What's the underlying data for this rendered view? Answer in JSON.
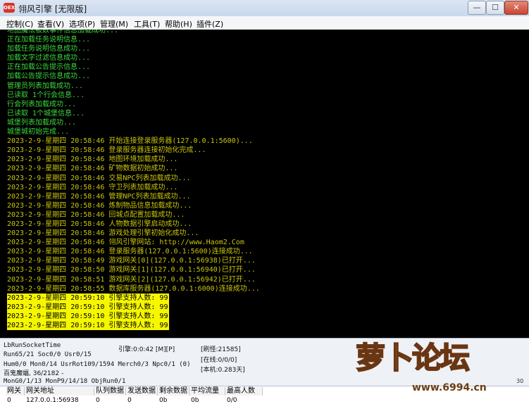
{
  "window": {
    "icon_label": "OEX",
    "title": "翎风引擎 [无限版]",
    "controls": {
      "minimize": "—",
      "maximize": "☐",
      "close": "✕"
    }
  },
  "menu": [
    "控制(C)",
    "查看(V)",
    "选项(P)",
    "管理(M)",
    "工具(T)",
    "帮助(H)",
    "插件(Z)"
  ],
  "console": {
    "lines": [
      {
        "text": "地图魔法被数事件信息加载成功...",
        "style": "green"
      },
      {
        "text": "正在加载任务说明信息...",
        "style": "green"
      },
      {
        "text": "加载任务说明信息成功...",
        "style": "green"
      },
      {
        "text": "加载文字过滤信息成功...",
        "style": "green"
      },
      {
        "text": "正在加载公告提示信息...",
        "style": "green"
      },
      {
        "text": "加载公告提示信息成功...",
        "style": "green"
      },
      {
        "text": "管理员列表加载成功...",
        "style": "green"
      },
      {
        "text": "已读取 1个行会信息...",
        "style": "green"
      },
      {
        "text": "行会列表加载成功...",
        "style": "green"
      },
      {
        "text": "已读取 1个城堡信息...",
        "style": "green"
      },
      {
        "text": "城堡列表加载成功...",
        "style": "green"
      },
      {
        "text": "城堡城初始完成...",
        "style": "green"
      },
      {
        "text": "2023-2-9-星期四 20:58:46 开始连接登录服务器(127.0.0.1:5600)...",
        "style": "olive"
      },
      {
        "text": "2023-2-9-星期四 20:58:46 登录服务器连接初始化完成...",
        "style": "olive"
      },
      {
        "text": "2023-2-9-星期四 20:58:46 地图环境加载成功...",
        "style": "olive"
      },
      {
        "text": "2023-2-9-星期四 20:58:46 矿物数据初始成功...",
        "style": "olive"
      },
      {
        "text": "2023-2-9-星期四 20:58:46 交易NPC列表加载成功...",
        "style": "olive"
      },
      {
        "text": "2023-2-9-星期四 20:58:46 守卫列表加载成功...",
        "style": "olive"
      },
      {
        "text": "2023-2-9-星期四 20:58:46 管理NPC列表加载成功...",
        "style": "olive"
      },
      {
        "text": "2023-2-9-星期四 20:58:46 炼制物品信息加载成功...",
        "style": "olive"
      },
      {
        "text": "2023-2-9-星期四 20:58:46 回城点配置加载成功...",
        "style": "olive"
      },
      {
        "text": "2023-2-9-星期四 20:58:46 人物数据引擎启动成功...",
        "style": "olive"
      },
      {
        "text": "2023-2-9-星期四 20:58:46 游戏处理引擎初始化成功...",
        "style": "olive"
      },
      {
        "text": "2023-2-9-星期四 20:58:46 翎风引擎网站: http://www.Haom2.Com",
        "style": "olive"
      },
      {
        "text": "2023-2-9-星期四 20:58:46 登录服务器(127.0.0.1:5600)连接成功...",
        "style": "olive"
      },
      {
        "text": "2023-2-9-星期四 20:58:49 游戏网关[0](127.0.0.1:56938)已打开...",
        "style": "olive"
      },
      {
        "text": "2023-2-9-星期四 20:58:50 游戏网关[1](127.0.0.1:56940)已打开...",
        "style": "olive"
      },
      {
        "text": "2023-2-9-星期四 20:58:51 游戏网关[2](127.0.0.1:56942)已打开...",
        "style": "olive"
      },
      {
        "text": "2023-2-9-星期四 20:58:55 数据库服务器(127.0.0.1:6000)连接成功...",
        "style": "olive"
      },
      {
        "text": "2023-2-9-星期四 20:59:10 引擎支持人数: 99",
        "style": "hl"
      },
      {
        "text": "2023-2-9-星期四 20:59:10 引擎支持人数: 99",
        "style": "hl"
      },
      {
        "text": "2023-2-9-星期四 20:59:10 引擎支持人数: 99",
        "style": "hl"
      },
      {
        "text": "2023-2-9-星期四 20:59:10 引擎支持人数: 99",
        "style": "hl"
      }
    ]
  },
  "status": {
    "run_socket": "LbRunSocketTime",
    "run": "Run65/21 Soc0/0 Usr0/15",
    "engine": "引擎:0:0:42 [M][P]",
    "refresh": "[刷怪:21585]",
    "online": "[在线:0/0/0]",
    "local": "[本机:0.283天]",
    "hum": "Hum0/0 Mon0/14 UsrRot109/1594 Merch0/3 Npc0/1 (0)",
    "bat": "百鬼魔蝠, 36/2182 -",
    "mon": "MonG0/1/13 MonP9/14/18 ObjRun0/1"
  },
  "table": {
    "headers": [
      "网关",
      "网关地址",
      "队列数据",
      "发送数据",
      "剩余数据",
      "平均流量",
      "最高人数"
    ],
    "rows": [
      [
        "0",
        "127.0.0.1:56938",
        "0",
        "0",
        "0b",
        "0b",
        "0/0"
      ]
    ]
  },
  "watermark": {
    "top": "萝卜论坛",
    "site": "www.6994.cn",
    "version": "30"
  }
}
